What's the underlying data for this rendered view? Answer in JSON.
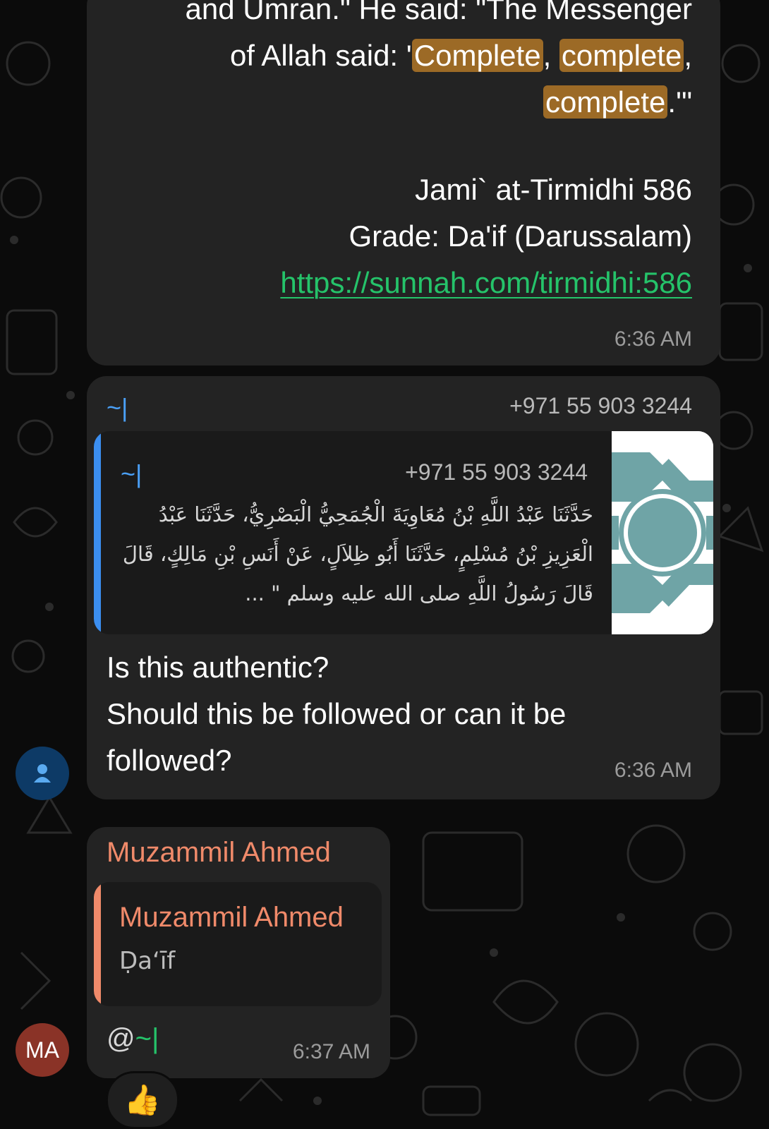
{
  "message1": {
    "lines": [
      {
        "segments": [
          {
            "text": "and Umran.\" He said: \"The Messenger",
            "hl": false
          }
        ]
      },
      {
        "segments": [
          {
            "text": "of Allah said: '",
            "hl": false
          },
          {
            "text": "Complete",
            "hl": true
          },
          {
            "text": ", ",
            "hl": false
          },
          {
            "text": "complete",
            "hl": true
          },
          {
            "text": ",",
            "hl": false
          }
        ]
      },
      {
        "segments": [
          {
            "text": "complete",
            "hl": true
          },
          {
            "text": ".'\"",
            "hl": false
          }
        ]
      }
    ],
    "reference": "Jami` at-Tirmidhi 586",
    "grade": "Grade: Da'if (Darussalam)",
    "link": "https://sunnah.com/tirmidhi:586",
    "time": "6:36 AM"
  },
  "message2": {
    "sender_name": "~|",
    "sender_phone": "+971 55 903 3244",
    "quoted": {
      "sender_name": "~|",
      "sender_phone": "+971 55 903 3244",
      "text": "حَدَّثَنَا عَبْدُ اللَّهِ بْنُ مُعَاوِيَةَ الْجُمَحِيُّ الْبَصْرِيُّ، حَدَّثَنَا عَبْدُ الْعَزِيزِ بْنُ مُسْلِمٍ، حَدَّثَنَا أَبُو ظِلاَلٍ، عَنْ أَنَسِ بْنِ مَالِكٍ، قَالَ قَالَ رَسُولُ اللَّهِ صلى الله عليه وسلم \" ..."
    },
    "text_line1": "Is this authentic?",
    "text_line2": "Should this be followed or can it be",
    "text_line3": "followed?",
    "time": "6:36 AM"
  },
  "message3": {
    "sender_name": "Muzammil Ahmed",
    "avatar_initials": "MA",
    "quoted": {
      "sender_name": "Muzammil Ahmed",
      "text": "Ḍaʻīf"
    },
    "mention_at": "@",
    "mention_name": "~|",
    "time": "6:37 AM",
    "reaction": "👍"
  },
  "colors": {
    "background": "#0b0b0b",
    "bubble": "#232323",
    "highlight": "#9c6a26",
    "link": "#25c36a",
    "sender_blue": "#4a9ff5",
    "sender_orange": "#f08a6a"
  }
}
